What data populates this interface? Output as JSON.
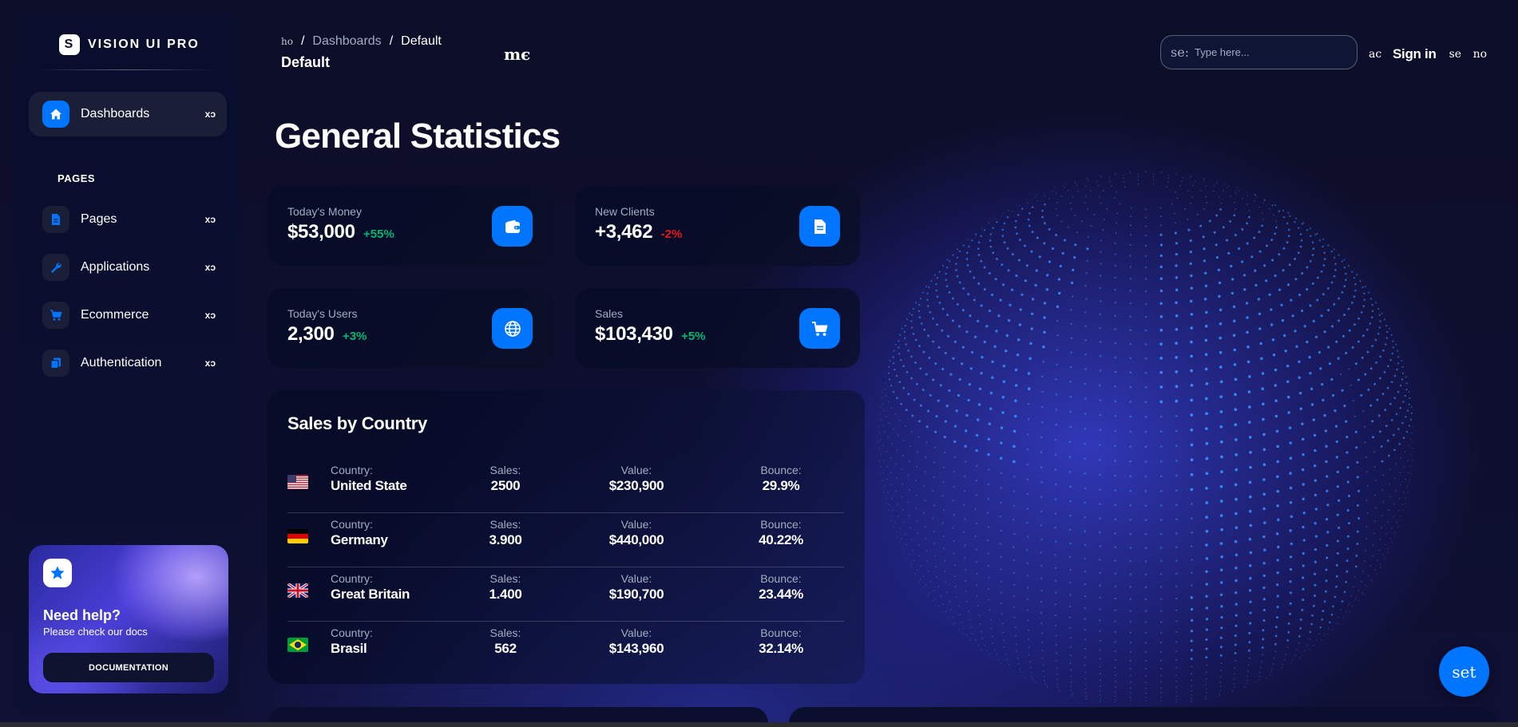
{
  "sidebar": {
    "brand": "VISION UI PRO",
    "brand_logo_letter": "S",
    "active_item": {
      "label": "Dashboards",
      "icon": "home-icon",
      "caret": "xɔ"
    },
    "section_label": "PAGES",
    "items": [
      {
        "label": "Pages",
        "icon": "document-icon",
        "caret": "xɔ"
      },
      {
        "label": "Applications",
        "icon": "wrench-icon",
        "caret": "xɔ"
      },
      {
        "label": "Ecommerce",
        "icon": "cart-icon",
        "caret": "xɔ"
      },
      {
        "label": "Authentication",
        "icon": "copy-icon",
        "caret": "xɔ"
      }
    ],
    "help": {
      "title": "Need help?",
      "subtitle": "Please check our docs",
      "button": "DOCUMENTATION",
      "icon": "star-icon"
    }
  },
  "topbar": {
    "breadcrumb": {
      "home": "ho",
      "sep1": "/",
      "level1": "Dashboards",
      "sep2": "/",
      "current": "Default"
    },
    "page_subtitle": "Default",
    "stray_text": "mє",
    "search": {
      "icon_text": "se:",
      "placeholder": "Type here..."
    },
    "account_icon_text": "ac",
    "signin": "Sign in",
    "settings_icon_text": "se",
    "notifications_icon_text": "no"
  },
  "main": {
    "title": "General Statistics",
    "stats": [
      {
        "label": "Today's Money",
        "value": "$53,000",
        "change": "+55%",
        "trend": "up",
        "icon": "wallet-icon"
      },
      {
        "label": "New Clients",
        "value": "+3,462",
        "change": "-2%",
        "trend": "down",
        "icon": "document-icon"
      },
      {
        "label": "Today's Users",
        "value": "2,300",
        "change": "+3%",
        "trend": "up",
        "icon": "globe-icon"
      },
      {
        "label": "Sales",
        "value": "$103,430",
        "change": "+5%",
        "trend": "up",
        "icon": "cart-icon"
      }
    ],
    "sales_by_country": {
      "title": "Sales by Country",
      "column_labels": {
        "country": "Country:",
        "sales": "Sales:",
        "value": "Value:",
        "bounce": "Bounce:"
      },
      "rows": [
        {
          "flag": "us-flag",
          "country": "United State",
          "sales": "2500",
          "value": "$230,900",
          "bounce": "29.9%"
        },
        {
          "flag": "de-flag",
          "country": "Germany",
          "sales": "3.900",
          "value": "$440,000",
          "bounce": "40.22%"
        },
        {
          "flag": "gb-flag",
          "country": "Great Britain",
          "sales": "1.400",
          "value": "$190,700",
          "bounce": "23.44%"
        },
        {
          "flag": "br-flag",
          "country": "Brasil",
          "sales": "562",
          "value": "$143,960",
          "bounce": "32.14%"
        }
      ]
    }
  },
  "fab": {
    "label": "set",
    "icon": "settings-icon"
  },
  "colors": {
    "accent": "#0075ff",
    "positive": "#01b574",
    "negative": "#e31a1a",
    "muted": "#a0aec0",
    "globe": "#3b8cff"
  }
}
